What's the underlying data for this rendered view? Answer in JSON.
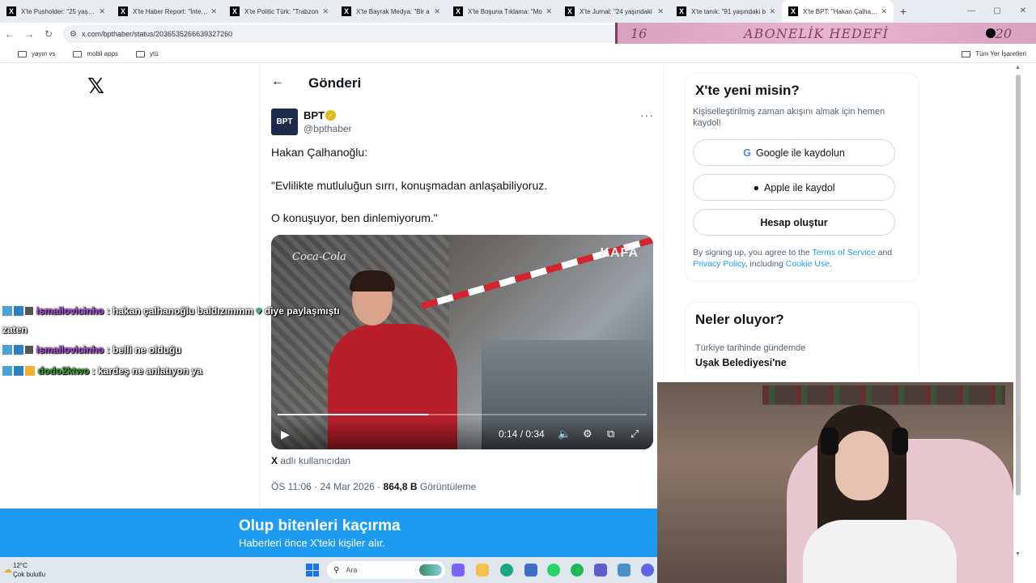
{
  "browser": {
    "tabs": [
      {
        "title": "X'te Pusholder: \"25 yaşında"
      },
      {
        "title": "X'te Haber Report: \"İnternet"
      },
      {
        "title": "X'te Politic Türk: \"Trabzon"
      },
      {
        "title": "X'te Bayrak Medya: \"Bir a"
      },
      {
        "title": "X'te Boşuna Tıklama: \"Mo"
      },
      {
        "title": "X'te Jurnal: \"24 yaşındaki"
      },
      {
        "title": "X'te tanık: \"91 yaşındaki b"
      },
      {
        "title": "X'te BPT: \"Hakan Çalhano"
      }
    ],
    "url": "x.com/bpthaber/status/2036535266639327260",
    "bookmarks": [
      "yayın vs",
      "mobil apps",
      "ytü"
    ],
    "bookmarks_all": "Tüm Yer İşaretleri"
  },
  "stream_overlay": {
    "subscriber_count": "16",
    "goal_label": "ABONELİK HEDEFİ",
    "goal_target": "20"
  },
  "page": {
    "title": "Gönderi"
  },
  "tweet": {
    "author": "BPT",
    "handle": "@bpthaber",
    "avatar_text": "BPT",
    "lines": [
      "Hakan Çalhanoğlu:",
      "\"Evlilikte mutluluğun sırrı, konuşmadan anlaşabiliyoruz.",
      "O konuşuyor, ben dinlemiyorum.\""
    ],
    "video": {
      "brand_left": "Coca-Cola",
      "brand_right": "KAFA",
      "time": "0:14 / 0:34",
      "progress": 0.41
    },
    "source_prefix": "X",
    "source_suffix": "adlı kullanıcıdan",
    "timestamp": "ÖS 11:06 · 24 Mar 2026 · ",
    "views": "864,8 B",
    "views_label": "Görüntüleme"
  },
  "signup": {
    "title": "X'te yeni misin?",
    "subtitle": "Kişiselleştirilmiş zaman akışını almak için hemen kaydol!",
    "google_label": "Google ile kaydolun",
    "apple_label": "Apple ile kaydol",
    "create_label": "Hesap oluştur",
    "terms_prefix": "By signing up, you agree to the",
    "terms_tos": "Terms of Service",
    "terms_and": "and",
    "terms_privacy": "Privacy Policy",
    "terms_including": ", including",
    "terms_cookie": "Cookie Use",
    "terms_end": "."
  },
  "trends": {
    "title": "Neler oluyor?",
    "items": [
      {
        "category": "Türkiye tarihinde gündemde",
        "name": "Uşak Belediyesi'ne"
      }
    ]
  },
  "chat": [
    {
      "user": "ismailovicinho",
      "text": ": hakan çalhanoğlu baldızımmm",
      "after": "diye paylaşmıştı",
      "wrap": "zaten"
    },
    {
      "user": "ismailovicinho",
      "text": ": belli ne olduğu"
    },
    {
      "user": "dodo2ktwo",
      "text": ": kardeş ne anlatıyon ya"
    }
  ],
  "banner": {
    "title": "Olup bitenleri kaçırma",
    "subtitle": "Haberleri önce X'teki kişiler alır."
  },
  "taskbar": {
    "temperature": "12°C",
    "weather": "Çok bulutlu",
    "search_placeholder": "Ara"
  },
  "colors": {
    "x_blue": "#1d9bf0",
    "chat_user_purple": "#b34de0",
    "chat_user_green": "#3aa02f"
  }
}
